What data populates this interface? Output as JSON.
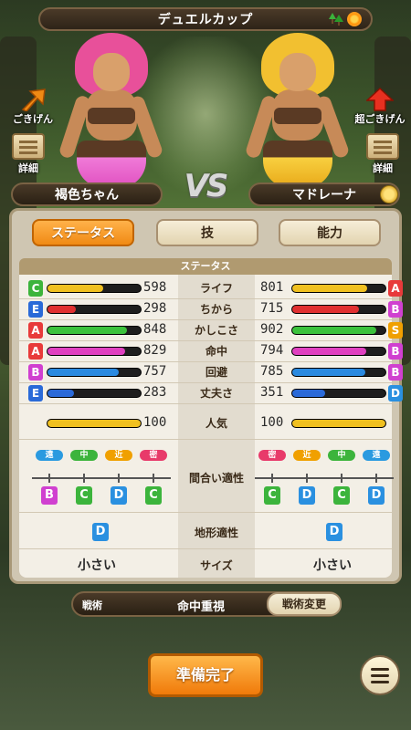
{
  "header": {
    "title": "デュエルカップ"
  },
  "left_fighter": {
    "name": "褐色ちゃん",
    "mood_label": "ごきげん",
    "detail_label": "詳細"
  },
  "right_fighter": {
    "name": "マドレーナ",
    "mood_label": "超ごきげん",
    "detail_label": "詳細"
  },
  "vs_label": "VS",
  "tabs": [
    {
      "label": "ステータス",
      "active": true
    },
    {
      "label": "技",
      "active": false
    },
    {
      "label": "能力",
      "active": false
    }
  ],
  "section_title": "ステータス",
  "stats": [
    {
      "label": "ライフ",
      "color": "#f0c020",
      "left": {
        "grade": "C",
        "value": "598",
        "fill": 0.6
      },
      "right": {
        "grade": "A",
        "value": "801",
        "fill": 0.8
      }
    },
    {
      "label": "ちから",
      "color": "#e03030",
      "left": {
        "grade": "E",
        "value": "298",
        "fill": 0.3
      },
      "right": {
        "grade": "B",
        "value": "715",
        "fill": 0.72
      }
    },
    {
      "label": "かしこさ",
      "color": "#3cc23c",
      "left": {
        "grade": "A",
        "value": "848",
        "fill": 0.85
      },
      "right": {
        "grade": "S",
        "value": "902",
        "fill": 0.9
      }
    },
    {
      "label": "命中",
      "color": "#e040c0",
      "left": {
        "grade": "A",
        "value": "829",
        "fill": 0.83
      },
      "right": {
        "grade": "B",
        "value": "794",
        "fill": 0.79
      }
    },
    {
      "label": "回避",
      "color": "#2a8ae0",
      "left": {
        "grade": "B",
        "value": "757",
        "fill": 0.76
      },
      "right": {
        "grade": "B",
        "value": "785",
        "fill": 0.78
      }
    },
    {
      "label": "丈夫さ",
      "color": "#2a6ad8",
      "left": {
        "grade": "E",
        "value": "283",
        "fill": 0.28
      },
      "right": {
        "grade": "D",
        "value": "351",
        "fill": 0.35
      }
    }
  ],
  "popularity": {
    "label": "人気",
    "color": "#f0c020",
    "left": {
      "value": "100",
      "fill": 1.0
    },
    "right": {
      "value": "100",
      "fill": 1.0
    }
  },
  "distance": {
    "label": "間合い適性",
    "left": {
      "ranges": [
        "遠",
        "中",
        "近",
        "密"
      ],
      "grades": [
        "B",
        "C",
        "D",
        "C"
      ]
    },
    "right": {
      "ranges": [
        "密",
        "近",
        "中",
        "遠"
      ],
      "grades": [
        "C",
        "D",
        "C",
        "D"
      ]
    }
  },
  "terrain": {
    "label": "地形適性",
    "left": "D",
    "right": "D"
  },
  "size": {
    "label": "サイズ",
    "left": "小さい",
    "right": "小さい"
  },
  "tactics": {
    "label": "戦術",
    "value": "命中重視",
    "button": "戦術変更"
  },
  "ready_button": "準備完了",
  "grade_colors": {
    "S": "#f0a000",
    "A": "#e83a3a",
    "B": "#d040d0",
    "C": "#3cb43c",
    "D": "#2a90e0",
    "E": "#2a6ad8"
  },
  "range_colors": {
    "遠": "#2a9ae0",
    "中": "#3cb43c",
    "近": "#f0a000",
    "密": "#e83a6a"
  }
}
